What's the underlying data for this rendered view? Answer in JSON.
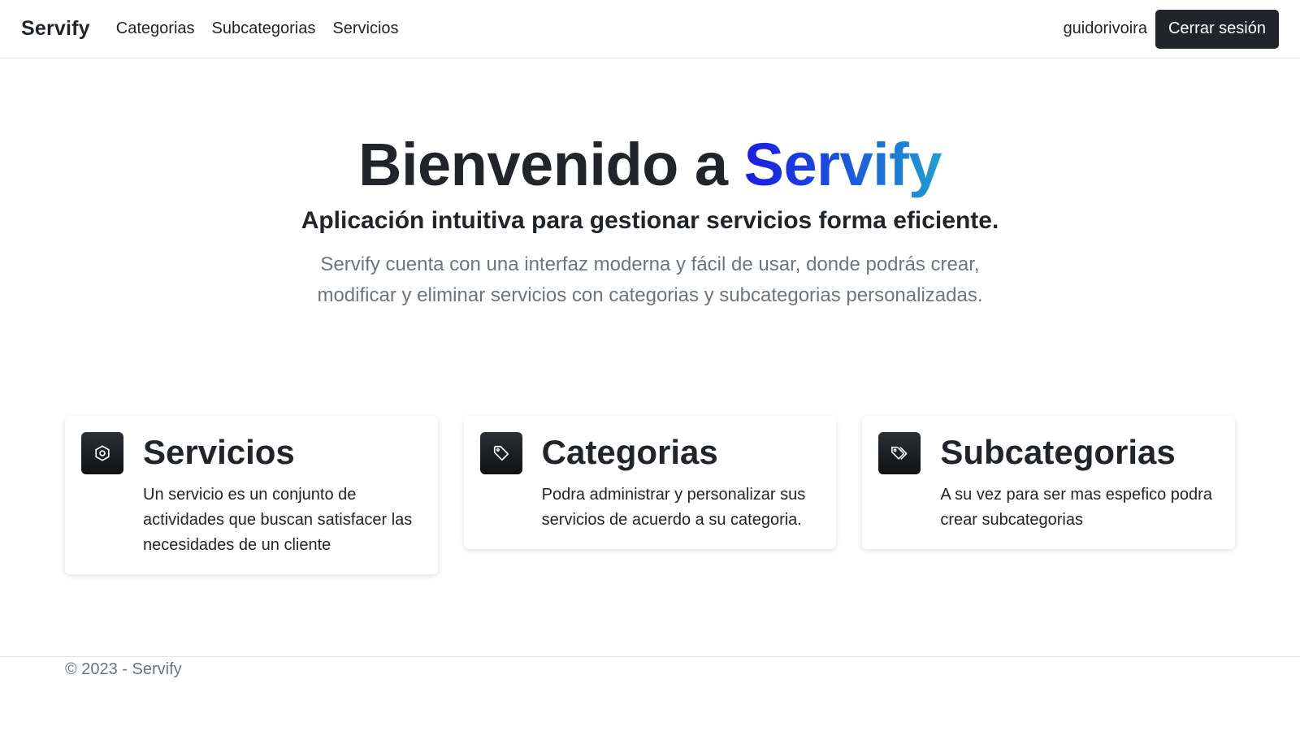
{
  "navbar": {
    "brand": "Servify",
    "links": [
      "Categorias",
      "Subcategorias",
      "Servicios"
    ],
    "username": "guidorivoira",
    "logout_label": "Cerrar sesión"
  },
  "hero": {
    "title_prefix": "Bienvenido a ",
    "title_highlight": "Servify",
    "lead": "Aplicación intuitiva para gestionar servicios forma eficiente.",
    "description": "Servify cuenta con una interfaz moderna y fácil de usar, donde podrás crear, modificar y eliminar servicios con categorias y subcategorias personalizadas."
  },
  "cards": [
    {
      "icon": "hexagon-icon",
      "title": "Servicios",
      "text": "Un servicio es un conjunto de actividades que buscan satisfacer las necesidades de un cliente"
    },
    {
      "icon": "tag-icon",
      "title": "Categorias",
      "text": "Podra administrar y personalizar sus servicios de acuerdo a su categoria."
    },
    {
      "icon": "tags-icon",
      "title": "Subcategorias",
      "text": "A su vez para ser mas espefico podra crear subcategorias"
    }
  ],
  "footer": {
    "text": "© 2023 - Servify"
  },
  "colors": {
    "dark": "#212529",
    "muted": "#6c757d",
    "gradient_start": "#1c1ce0",
    "gradient_end": "#1ea0d0"
  }
}
